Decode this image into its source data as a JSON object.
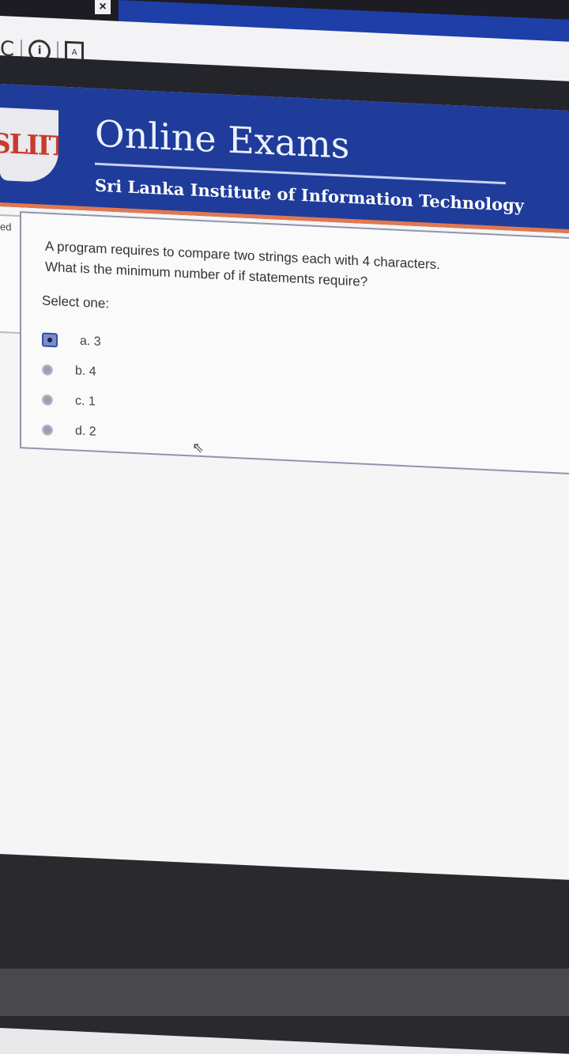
{
  "browser": {
    "tab_close_glyph": "×",
    "reload_glyph": "C",
    "info_glyph": "i",
    "pdf_glyph": "A"
  },
  "header": {
    "logo_text": "SLIIT",
    "title": "Online Exams",
    "subtitle": "Sri Lanka Institute of Information Technology"
  },
  "side_panel": {
    "text": "ed"
  },
  "question": {
    "text_line1": "A program requires to compare two strings each with 4 characters.",
    "text_line2": "What is the minimum number of if statements require?",
    "select_label": "Select one:",
    "options": [
      {
        "label": "a. 3",
        "selected": true
      },
      {
        "label": "b. 4",
        "selected": false
      },
      {
        "label": "c. 1",
        "selected": false
      },
      {
        "label": "d. 2",
        "selected": false
      }
    ]
  },
  "colors": {
    "header_blue": "#1f3c9a",
    "accent_orange": "#e3784f",
    "logo_red": "#c73b2d"
  }
}
